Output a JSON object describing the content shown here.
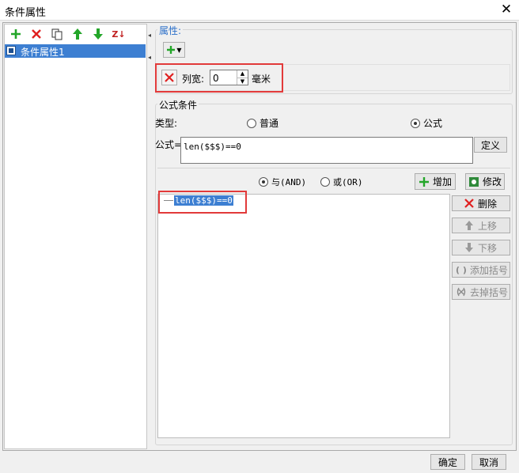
{
  "window": {
    "title": "条件属性",
    "close_glyph": "✕"
  },
  "left_toolbar": {
    "icons": [
      "add-icon",
      "delete-icon",
      "copy-icon",
      "move-up-icon",
      "move-down-icon",
      "sort-icon"
    ],
    "sort_glyph": "Z↓"
  },
  "tree": {
    "items": [
      {
        "label": "条件属性1",
        "selected": true
      }
    ]
  },
  "properties": {
    "legend": "属性:",
    "add_glyph": "+▾",
    "column_width_label": "列宽:",
    "column_width_value": "0",
    "unit": "毫米"
  },
  "formula_conditions": {
    "legend": "公式条件",
    "type_label": "类型:",
    "type_options": [
      {
        "label": "普通",
        "selected": false
      },
      {
        "label": "公式",
        "selected": true
      }
    ],
    "formula_label": "公式=",
    "formula_value": "len($$$)==0",
    "define_button": "定义",
    "logic_options": [
      {
        "label": "与(AND)",
        "selected": true
      },
      {
        "label": "或(OR)",
        "selected": false
      }
    ],
    "add_button": "增加",
    "modify_button": "修改",
    "condition_list": [
      "len($$$)==0"
    ],
    "side_buttons": {
      "delete": "删除",
      "move_up": "上移",
      "move_down": "下移",
      "add_bracket": "添加括号",
      "remove_bracket": "去掉括号"
    }
  },
  "footer": {
    "ok": "确定",
    "cancel": "取消"
  },
  "colors": {
    "selection": "#3d7fd2",
    "highlight_box": "#e23a3a",
    "add_green": "#23a629",
    "delete_red": "#e02020"
  }
}
